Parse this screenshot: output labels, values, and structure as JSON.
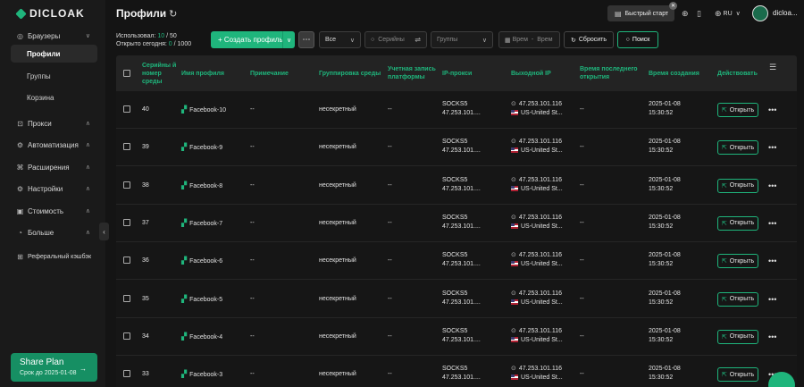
{
  "app": {
    "logo": "DICLOAK"
  },
  "sidebar": {
    "groups": [
      {
        "label": "Браузеры",
        "icon": "browser-icon",
        "expanded": true,
        "items": [
          {
            "label": "Профили",
            "active": true
          },
          {
            "label": "Группы"
          },
          {
            "label": "Корзина"
          }
        ]
      },
      {
        "label": "Прокси",
        "icon": "proxy-icon"
      },
      {
        "label": "Автоматизация",
        "icon": "automation-icon"
      },
      {
        "label": "Расширения",
        "icon": "extensions-icon"
      },
      {
        "label": "Настройки",
        "icon": "settings-icon"
      },
      {
        "label": "Стоимость",
        "icon": "billing-icon"
      },
      {
        "label": "Больше",
        "icon": "more-icon"
      },
      {
        "label": "Реферальный кэшбэк",
        "icon": "referral-icon"
      }
    ],
    "share_plan": {
      "title": "Share Plan",
      "subtitle": "Срок до 2025-01-08"
    }
  },
  "header": {
    "title": "Профили",
    "quick_start": "Быстрый старт",
    "language": "RU",
    "username": "dicloa..."
  },
  "toolbar": {
    "used_label": "Использовал:",
    "used_value": "10",
    "used_limit": "/ 50",
    "opened_label": "Открыто сегодня:",
    "opened_value": "0",
    "opened_limit": "/ 1000",
    "create_label": "+ Создать профиль",
    "filter_all": "Все",
    "serial_placeholder": "Серийны",
    "groups_placeholder": "Группы",
    "time_from": "Врем",
    "time_to": "Врем",
    "reset_label": "Сбросить",
    "search_label": "Поиск"
  },
  "table": {
    "columns": {
      "serial": "Серийны й номер среды",
      "name": "Имя профиля",
      "note": "Примечание",
      "group": "Группировка среды",
      "account": "Учетная запись платформы",
      "proxy": "IP-прокси",
      "exit_ip": "Выходной IP",
      "last_open": "Время последнего открытия",
      "created": "Время создания",
      "action": "Действовать"
    },
    "open_label": "Открыть",
    "rows": [
      {
        "serial": "40",
        "name": "Facebook-10",
        "note": "--",
        "group": "несекретный",
        "account": "--",
        "proxy_type": "SOCKS5",
        "proxy_ip": "47.253.101....",
        "exit_ip": "47.253.101.116",
        "country": "US-United St...",
        "last_open": "--",
        "created_date": "2025-01-08",
        "created_time": "15:30:52"
      },
      {
        "serial": "39",
        "name": "Facebook-9",
        "note": "--",
        "group": "несекретный",
        "account": "--",
        "proxy_type": "SOCKS5",
        "proxy_ip": "47.253.101....",
        "exit_ip": "47.253.101.116",
        "country": "US-United St...",
        "last_open": "--",
        "created_date": "2025-01-08",
        "created_time": "15:30:52"
      },
      {
        "serial": "38",
        "name": "Facebook-8",
        "note": "--",
        "group": "несекретный",
        "account": "--",
        "proxy_type": "SOCKS5",
        "proxy_ip": "47.253.101....",
        "exit_ip": "47.253.101.116",
        "country": "US-United St...",
        "last_open": "--",
        "created_date": "2025-01-08",
        "created_time": "15:30:52"
      },
      {
        "serial": "37",
        "name": "Facebook-7",
        "note": "--",
        "group": "несекретный",
        "account": "--",
        "proxy_type": "SOCKS5",
        "proxy_ip": "47.253.101....",
        "exit_ip": "47.253.101.116",
        "country": "US-United St...",
        "last_open": "--",
        "created_date": "2025-01-08",
        "created_time": "15:30:52"
      },
      {
        "serial": "36",
        "name": "Facebook-6",
        "note": "--",
        "group": "несекретный",
        "account": "--",
        "proxy_type": "SOCKS5",
        "proxy_ip": "47.253.101....",
        "exit_ip": "47.253.101.116",
        "country": "US-United St...",
        "last_open": "--",
        "created_date": "2025-01-08",
        "created_time": "15:30:52"
      },
      {
        "serial": "35",
        "name": "Facebook-5",
        "note": "--",
        "group": "несекретный",
        "account": "--",
        "proxy_type": "SOCKS5",
        "proxy_ip": "47.253.101....",
        "exit_ip": "47.253.101.116",
        "country": "US-United St...",
        "last_open": "--",
        "created_date": "2025-01-08",
        "created_time": "15:30:52"
      },
      {
        "serial": "34",
        "name": "Facebook-4",
        "note": "--",
        "group": "несекретный",
        "account": "--",
        "proxy_type": "SOCKS5",
        "proxy_ip": "47.253.101....",
        "exit_ip": "47.253.101.116",
        "country": "US-United St...",
        "last_open": "--",
        "created_date": "2025-01-08",
        "created_time": "15:30:52"
      },
      {
        "serial": "33",
        "name": "Facebook-3",
        "note": "--",
        "group": "несекретный",
        "account": "--",
        "proxy_type": "SOCKS5",
        "proxy_ip": "47.253.101....",
        "exit_ip": "47.253.101.116",
        "country": "US-United St...",
        "last_open": "--",
        "created_date": "2025-01-08",
        "created_time": "15:30:52"
      }
    ]
  },
  "colors": {
    "accent": "#1fb57c",
    "background": "#141414",
    "sidebar": "#1a1a1a"
  }
}
